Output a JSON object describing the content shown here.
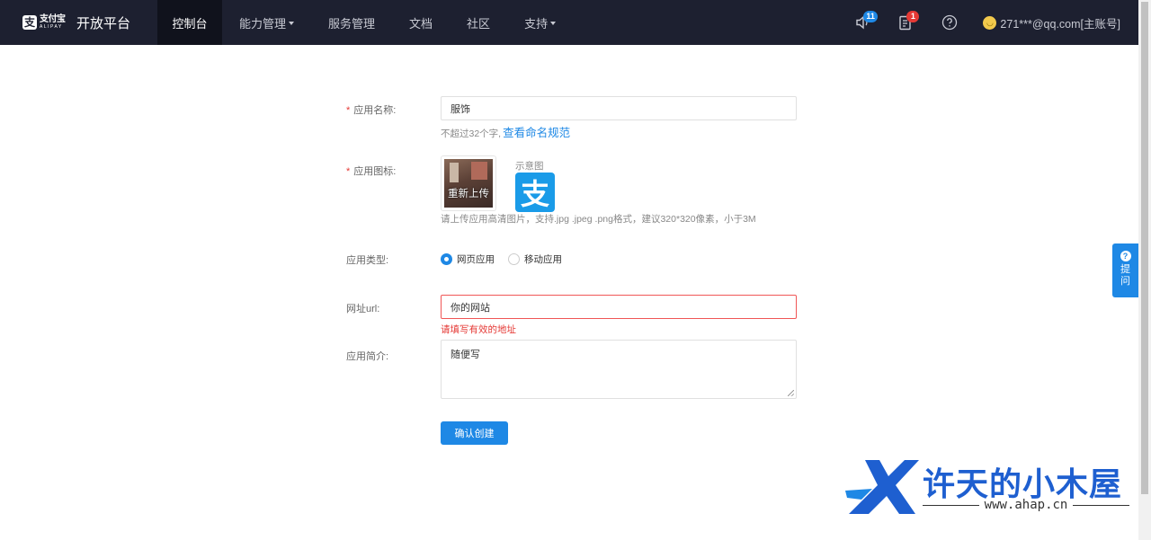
{
  "nav": {
    "logo_cn": "支付宝",
    "logo_en": "ALIPAY",
    "title": "开放平台",
    "items": [
      {
        "label": "控制台",
        "active": true
      },
      {
        "label": "能力管理",
        "dropdown": true
      },
      {
        "label": "服务管理"
      },
      {
        "label": "文档"
      },
      {
        "label": "社区"
      },
      {
        "label": "支持",
        "dropdown": true
      }
    ],
    "notifications_count": "11",
    "messages_count": "1",
    "account": "271***@qq.com[主账号]"
  },
  "form": {
    "app_name_label": "应用名称:",
    "app_name_value": "服饰",
    "app_name_hint": "不超过32个字,",
    "naming_rules_link": "查看命名规范",
    "app_icon_label": "应用图标:",
    "reupload_label": "重新上传",
    "sample_label": "示意图",
    "sample_icon_glyph": "支",
    "icon_hint": "请上传应用高清图片，支持.jpg .jpeg .png格式，建议320*320像素，小于3M",
    "app_type_label": "应用类型:",
    "type_options": [
      {
        "label": "网页应用",
        "checked": true
      },
      {
        "label": "移动应用",
        "checked": false
      }
    ],
    "url_label": "网址url:",
    "url_value": "你的网站",
    "url_error": "请填写有效的地址",
    "intro_label": "应用简介:",
    "intro_value": "随便写",
    "submit_label": "确认创建",
    "required_mark": "*"
  },
  "help_tab": {
    "icon": "?",
    "label": "提问"
  },
  "watermark": {
    "title": "许天的小木屋",
    "url": "www.ahap.cn"
  },
  "colors": {
    "nav_bg": "#1d2030",
    "primary": "#1e88e5",
    "error": "#e53935"
  }
}
